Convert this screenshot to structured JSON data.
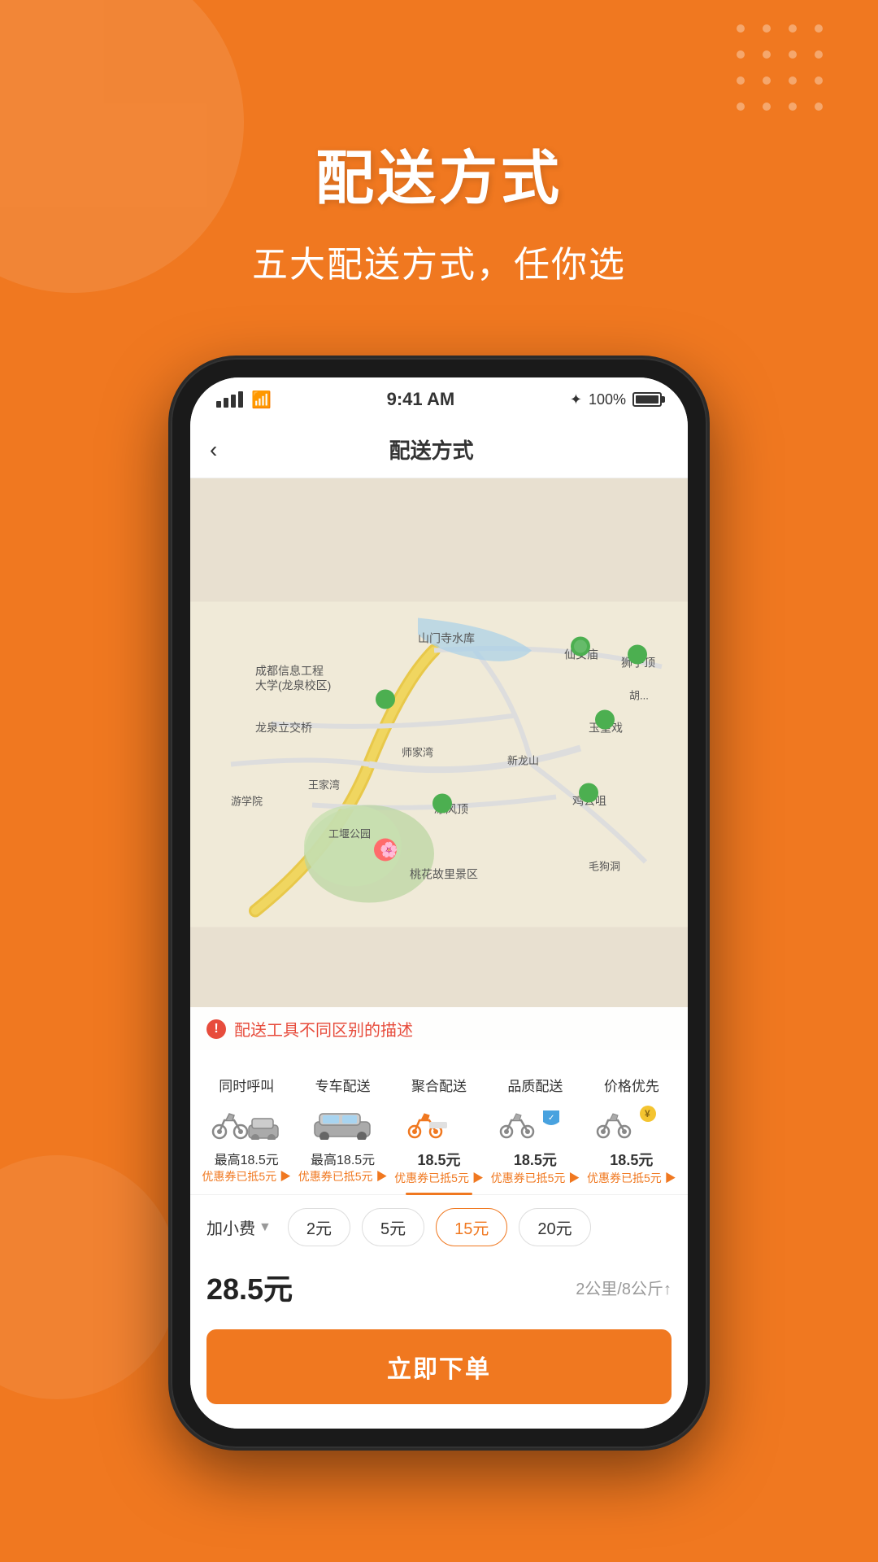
{
  "background": {
    "color": "#F07820"
  },
  "header": {
    "main_title": "配送方式",
    "sub_title": "五大配送方式，任你选"
  },
  "phone": {
    "status_bar": {
      "time": "9:41 AM",
      "battery": "100%",
      "signal": "full"
    },
    "nav": {
      "back_label": "‹",
      "title": "配送方式"
    },
    "map": {
      "warning_text": "配送工具不同区别的描述"
    },
    "services": [
      {
        "name": "同时呼叫",
        "price": "最高18.5元",
        "coupon": "优惠券已抵5元 ▶",
        "icon": "motorcycle_car",
        "active": false
      },
      {
        "name": "专车配送",
        "price": "最高18.5元",
        "coupon": "优惠券已抵5元 ▶",
        "icon": "car",
        "active": false
      },
      {
        "name": "聚合配送",
        "price": "18.5元",
        "coupon": "优惠券已抵5元 ▶",
        "icon": "motorcycle",
        "active": true
      },
      {
        "name": "品质配送",
        "price": "18.5元",
        "coupon": "优惠券已抵5元 ▶",
        "icon": "motorcycle_shield",
        "active": false
      },
      {
        "name": "价格优先",
        "price": "18.5元",
        "coupon": "优惠券已抵5元 ▶",
        "icon": "motorcycle_coin",
        "active": false
      }
    ],
    "extra_fee": {
      "label": "加小费",
      "options": [
        "2元",
        "5元",
        "15元",
        "20元"
      ],
      "active_option": "15元"
    },
    "total": {
      "price": "28.5元",
      "distance": "2公里/8公斤↑"
    },
    "order_button": "立即下单"
  },
  "decoration": {
    "dots": 16
  }
}
